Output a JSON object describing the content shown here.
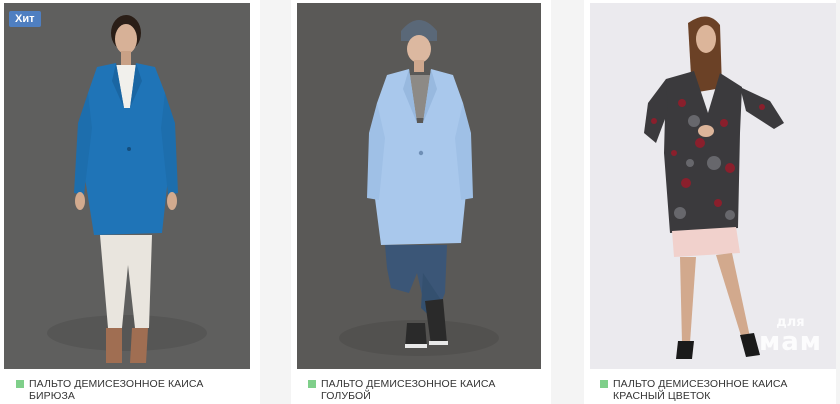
{
  "products": [
    {
      "badge": "Хит",
      "title": "ПАЛЬТО ДЕМИСЕЗОННОЕ КАИСА БИРЮЗА",
      "coat_color": "#1f74b7",
      "bg_color": "#5d5d5c"
    },
    {
      "badge": "",
      "title": "ПАЛЬТО ДЕМИСЕЗОННОЕ КАИСА ГОЛУБОЙ",
      "coat_color": "#a9c8ec",
      "bg_color": "#5b5a58"
    },
    {
      "badge": "",
      "title": "ПАЛЬТО ДЕМИСЕЗОННОЕ КАИСА КРАСНЫЙ ЦВЕТОК",
      "coat_color": "#3b3a3d",
      "bg_color": "#e9e8ec"
    }
  ],
  "watermark": {
    "line1": "для",
    "line2": "мам"
  },
  "colors": {
    "badge_bg": "#4f7fc1",
    "status_dot": "#7fcf8a"
  }
}
